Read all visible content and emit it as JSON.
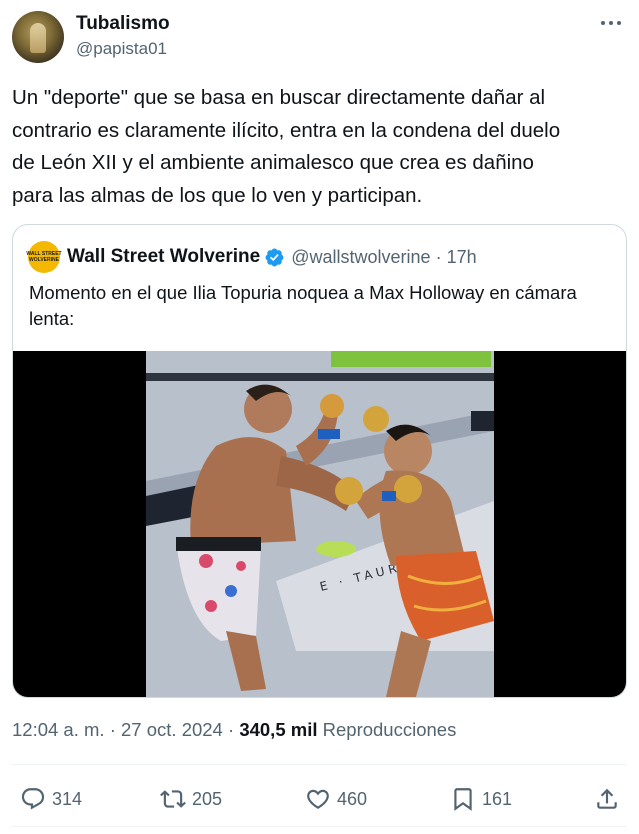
{
  "author": {
    "name": "Tubalismo",
    "handle": "@papista01"
  },
  "tweet": {
    "text": "Un \"deporte\" que se basa en buscar directamente dañar al\ncontrario es claramente ilícito, entra en la condena del duelo\nde León XII y el ambiente animalesco que crea es dañino\npara las almas de los que lo ven y participan."
  },
  "quote": {
    "avatar_text_top": "WALL STREET",
    "avatar_text_bottom": "WOLVERINE",
    "name": "Wall Street Wolverine",
    "handle": "@wallstwolverine",
    "separator": "·",
    "time": "17h",
    "text": "Momento en el que Ilia Topuria noquea a Max Holloway en cámara lenta:",
    "video_banner_text": "E · TAURI"
  },
  "meta": {
    "time": "12:04 a. m.",
    "separator": "·",
    "date": "27 oct. 2024",
    "views": "340,5 mil",
    "views_label": "Reproducciones"
  },
  "actions": {
    "replies": "314",
    "reposts": "205",
    "likes": "460",
    "bookmarks": "161"
  },
  "colors": {
    "text": "#0f1419",
    "secondary": "#536471",
    "border": "#cfd9de",
    "verified": "#1d9bf0",
    "wolverine_yellow": "#f5b800"
  }
}
